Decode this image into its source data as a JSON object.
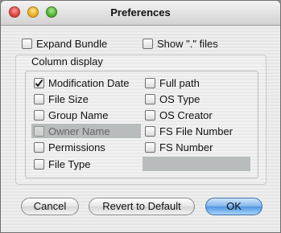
{
  "window": {
    "title": "Preferences"
  },
  "top_options": [
    {
      "label": "Expand Bundle",
      "checked": false
    },
    {
      "label": "Show \".\" files",
      "checked": false
    }
  ],
  "column_display": {
    "label": "Column display",
    "left": [
      {
        "label": "Modification Date",
        "checked": true,
        "enabled": true
      },
      {
        "label": "File Size",
        "checked": false,
        "enabled": true
      },
      {
        "label": "Group Name",
        "checked": false,
        "enabled": true
      },
      {
        "label": "Owner Name",
        "checked": false,
        "enabled": false
      },
      {
        "label": "Permissions",
        "checked": false,
        "enabled": true
      },
      {
        "label": "File Type",
        "checked": false,
        "enabled": true
      }
    ],
    "right": [
      {
        "label": "Full path",
        "checked": false
      },
      {
        "label": "OS Type",
        "checked": false
      },
      {
        "label": "OS Creator",
        "checked": false
      },
      {
        "label": "FS File Number",
        "checked": false
      },
      {
        "label": "FS Number",
        "checked": false
      }
    ]
  },
  "buttons": {
    "cancel": "Cancel",
    "revert": "Revert to Default",
    "ok": "OK"
  },
  "colors": {
    "accent": "#4f95e2",
    "highlight": "#b8bcbc"
  }
}
